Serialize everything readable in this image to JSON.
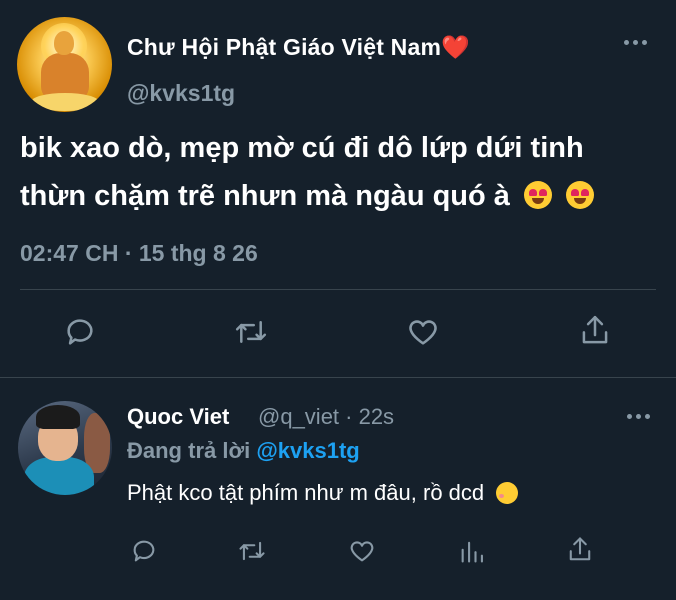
{
  "main_tweet": {
    "display_name": "Chư Hội Phật Giáo Việt Nam",
    "name_emoji": "❤️",
    "handle": "@kvks1tg",
    "text_line1": "bik xao dò, mẹp mờ cú đi dô lứp dứi tinh",
    "text_line2": "thừn chặm trẽ nhưn mà ngàu quó à",
    "timestamp": "02:47 CH · 15 thg 8 26",
    "actions": [
      "reply-icon",
      "retweet-icon",
      "like-icon",
      "share-icon"
    ]
  },
  "reply_tweet": {
    "display_name": "Quoc Viet",
    "handle_time": "@q_viet · 22s",
    "replying_prefix": "Đang trả lời",
    "replying_to": "@kvks1tg",
    "text": "Phật kco tật phím như m đâu, rồ dcd",
    "actions": [
      "reply-icon",
      "retweet-icon",
      "like-icon",
      "analytics-icon",
      "share-icon"
    ]
  },
  "colors": {
    "background": "#15202b",
    "text": "#ffffff",
    "muted": "#8899a6",
    "link": "#1da1f2",
    "divider": "#38444d"
  }
}
